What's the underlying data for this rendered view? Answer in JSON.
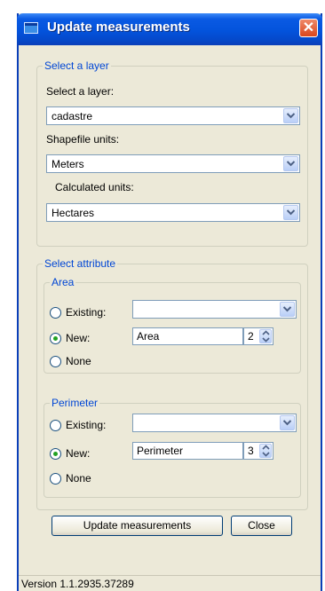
{
  "window": {
    "title": "Update measurements"
  },
  "layer_group": {
    "legend": "Select a layer",
    "layer_label": "Select a layer:",
    "layer_value": "cadastre",
    "shapefile_units_label": "Shapefile units:",
    "shapefile_units_value": "Meters",
    "calculated_units_label": "Calculated units:",
    "calculated_units_value": "Hectares"
  },
  "attribute_group": {
    "legend": "Select attribute",
    "area": {
      "legend": "Area",
      "existing_label": "Existing:",
      "existing_value": "",
      "new_label": "New:",
      "new_value": "Area",
      "decimals": "2",
      "none_label": "None",
      "selected": "new"
    },
    "perimeter": {
      "legend": "Perimeter",
      "existing_label": "Existing:",
      "existing_value": "",
      "new_label": "New:",
      "new_value": "Perimeter",
      "decimals": "3",
      "none_label": "None",
      "selected": "new"
    }
  },
  "buttons": {
    "update": "Update measurements",
    "close": "Close"
  },
  "status": {
    "version": "Version 1.1.2935.37289"
  },
  "colors": {
    "title_bar": "#0353dc",
    "group_legend": "#0046d5",
    "window_bg": "#ece9d8"
  },
  "icons": {
    "window": "app-window-icon",
    "close": "close-x-icon",
    "dropdown": "chevron-down-icon",
    "spinner": "up-down-arrows-icon"
  }
}
